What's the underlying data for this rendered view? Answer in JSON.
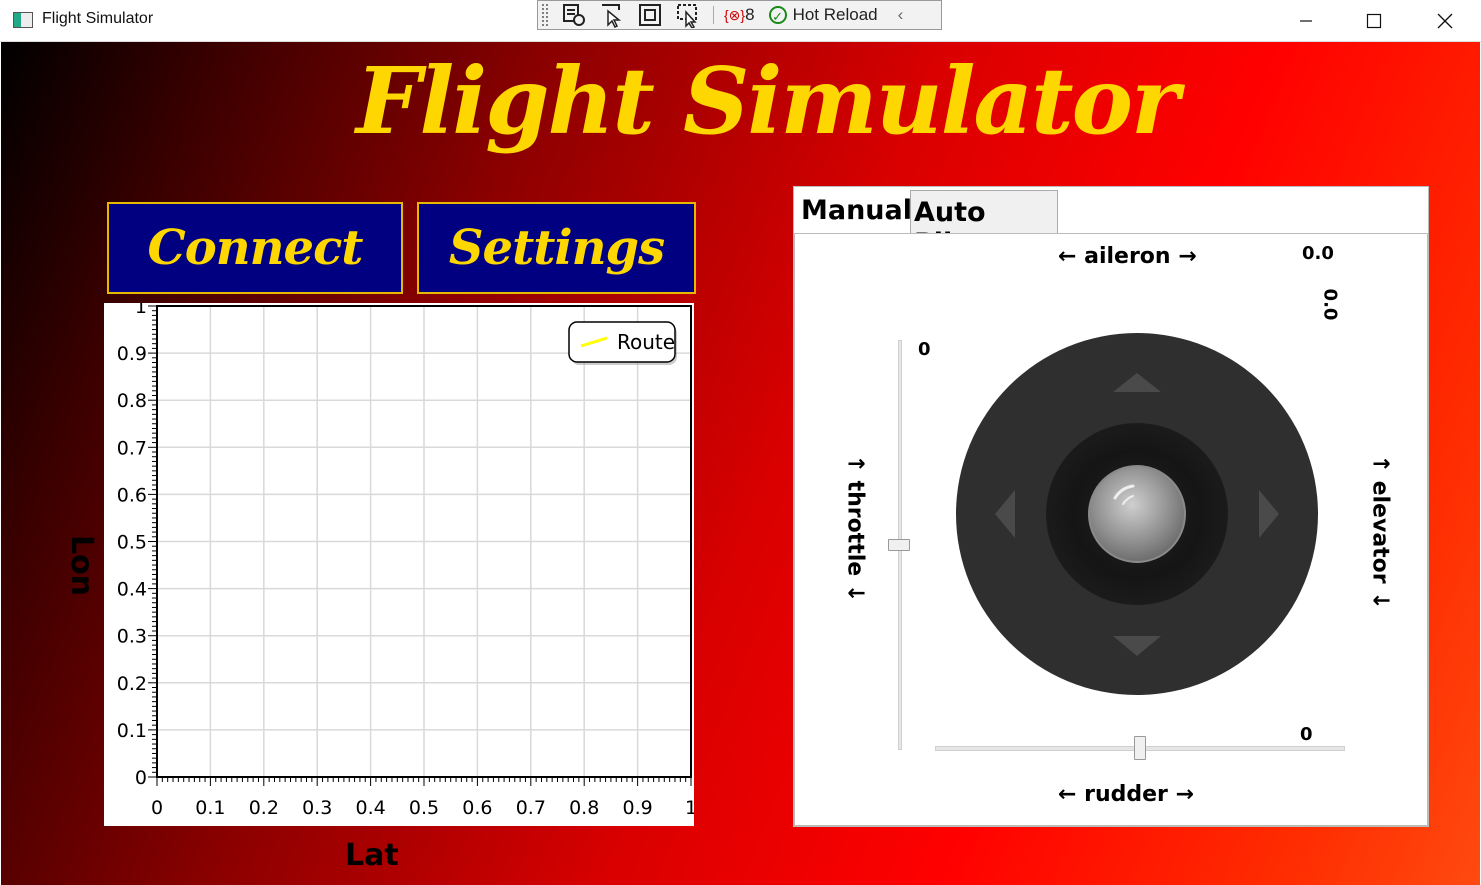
{
  "window": {
    "title": "Flight Simulator",
    "debug_toolbar": {
      "error_count": "8",
      "hot_reload_label": "Hot Reload"
    }
  },
  "app": {
    "heading": "Flight Simulator",
    "connect_label": "Connect",
    "settings_label": "Settings"
  },
  "chart_data": {
    "type": "line",
    "series": [
      {
        "name": "Route",
        "color": "#ffff00",
        "values": []
      }
    ],
    "xlabel": "Lat",
    "ylabel": "Lon",
    "xlim": [
      0,
      1
    ],
    "ylim": [
      0,
      1
    ],
    "x_ticks": [
      "0",
      "0.1",
      "0.2",
      "0.3",
      "0.4",
      "0.5",
      "0.6",
      "0.7",
      "0.8",
      "0.9",
      "1"
    ],
    "y_ticks": [
      "0",
      "0.1",
      "0.2",
      "0.3",
      "0.4",
      "0.5",
      "0.6",
      "0.7",
      "0.8",
      "0.9",
      "1"
    ],
    "grid": true,
    "legend_position": "top-right"
  },
  "controls": {
    "tabs": [
      {
        "label": "Manual",
        "selected": true
      },
      {
        "label": "Auto Pilot",
        "selected": false
      }
    ],
    "aileron_label": "← aileron →",
    "aileron_value": "0.0",
    "elevator_label": "↑ elevator ↓",
    "elevator_value": "0.0",
    "throttle_label": "↑ throttle ↓",
    "throttle_value": "0",
    "throttle_level": 0.5,
    "rudder_label": "← rudder →",
    "rudder_value": "0",
    "rudder_level": 0.5
  },
  "colors": {
    "title_gold": "#ffd700",
    "button_navy": "#000080",
    "button_border": "#e6b800",
    "route_line": "#ffff00"
  }
}
